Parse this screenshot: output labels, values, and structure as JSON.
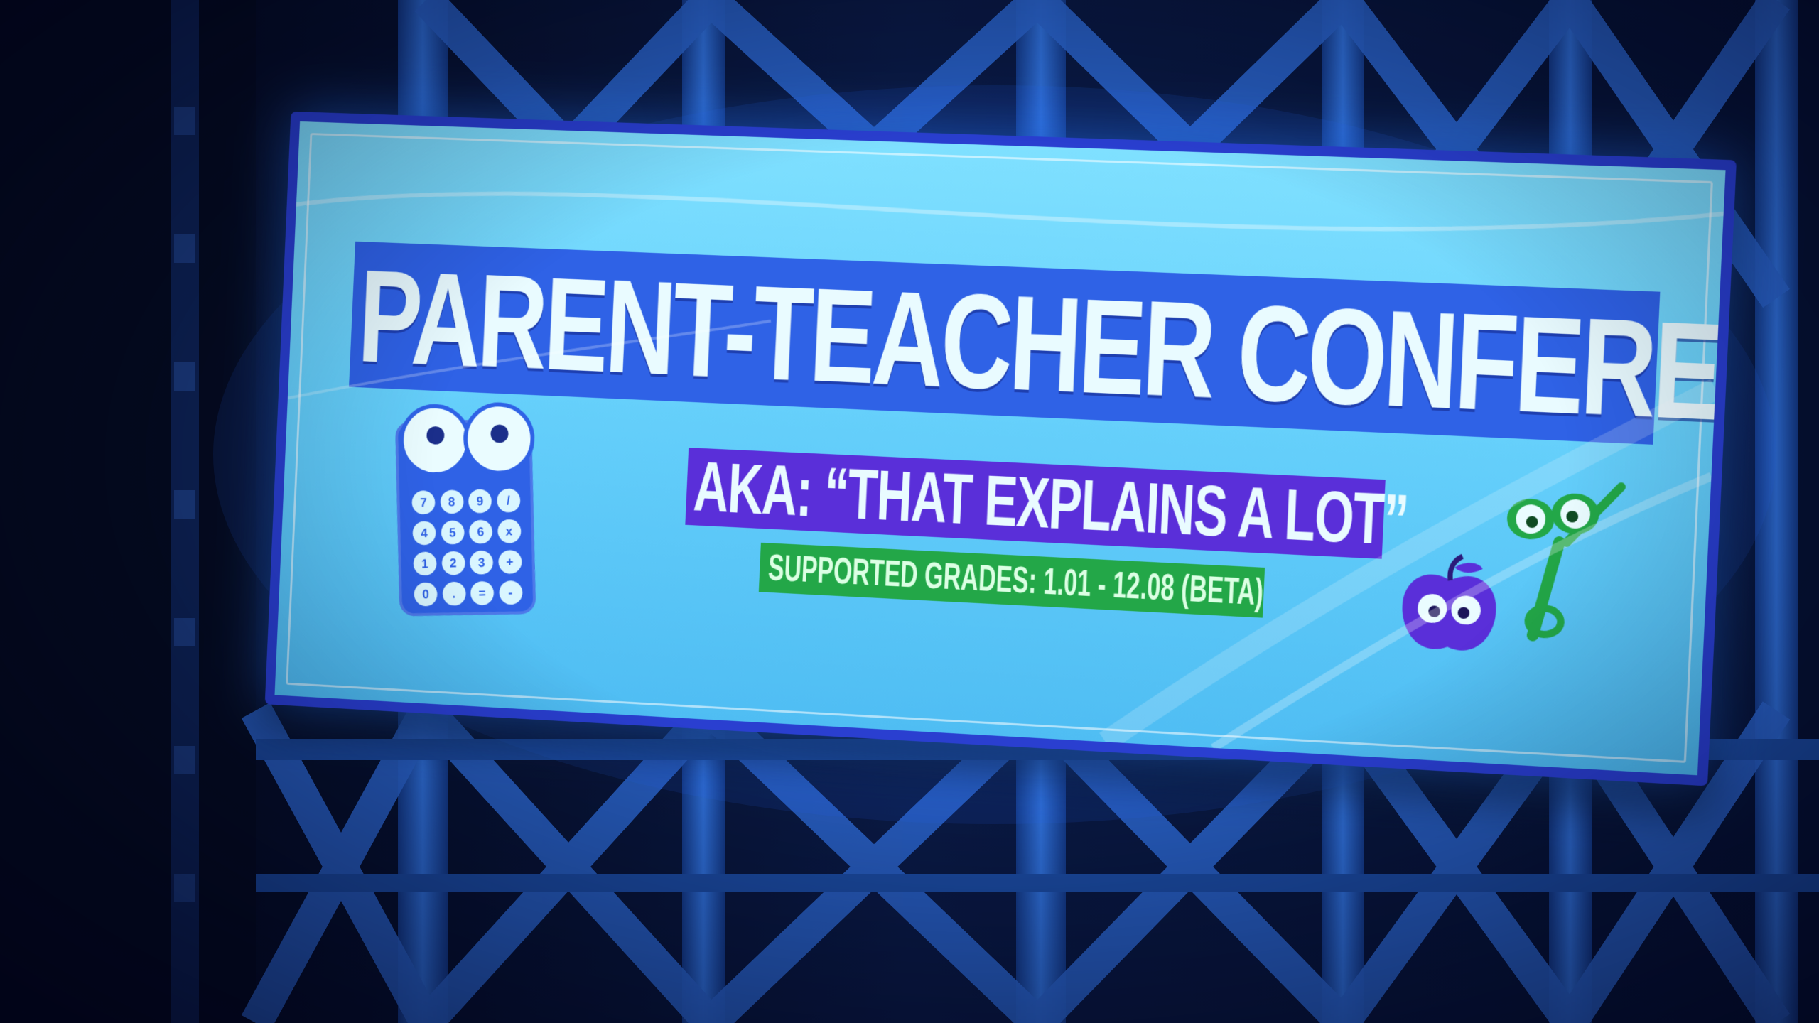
{
  "banner": {
    "title": "PARENT-TEACHER CONFERENCES",
    "aka": "AKA: “THAT EXPLAINS A LOT”",
    "grades": "SUPPORTED GRADES: 1.01 - 12.08 (BETA)"
  },
  "calculator": {
    "keys": [
      "7",
      "8",
      "9",
      "/",
      "4",
      "5",
      "6",
      "x",
      "1",
      "2",
      "3",
      "+",
      "0",
      ".",
      "=",
      "-"
    ]
  },
  "colors": {
    "background": "#06102a",
    "gate": "#1f4fa8",
    "banner": "#66d0fb",
    "title_band": "#2f62e6",
    "aka_band": "#5a2fd9",
    "grades_band": "#23a748"
  },
  "icons": [
    "calculator-mascot-icon",
    "apple-mascot-icon",
    "scissors-mascot-icon"
  ]
}
